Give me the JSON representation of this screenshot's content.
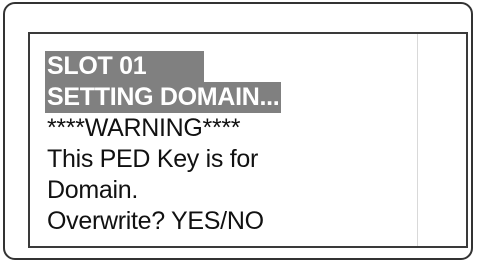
{
  "screen": {
    "lines": [
      {
        "text": "SLOT 01",
        "highlighted": true
      },
      {
        "text": "SETTING DOMAIN...",
        "highlighted": true
      },
      {
        "text": "****WARNING****",
        "highlighted": false
      },
      {
        "text": "This PED Key is for",
        "highlighted": false
      },
      {
        "text": "Domain.",
        "highlighted": false
      },
      {
        "text": "Overwrite?  YES/NO",
        "highlighted": false
      }
    ]
  },
  "colors": {
    "highlight_background": "#808080",
    "highlight_text": "#ffffff",
    "text": "#111111",
    "frame_border": "#333333"
  }
}
